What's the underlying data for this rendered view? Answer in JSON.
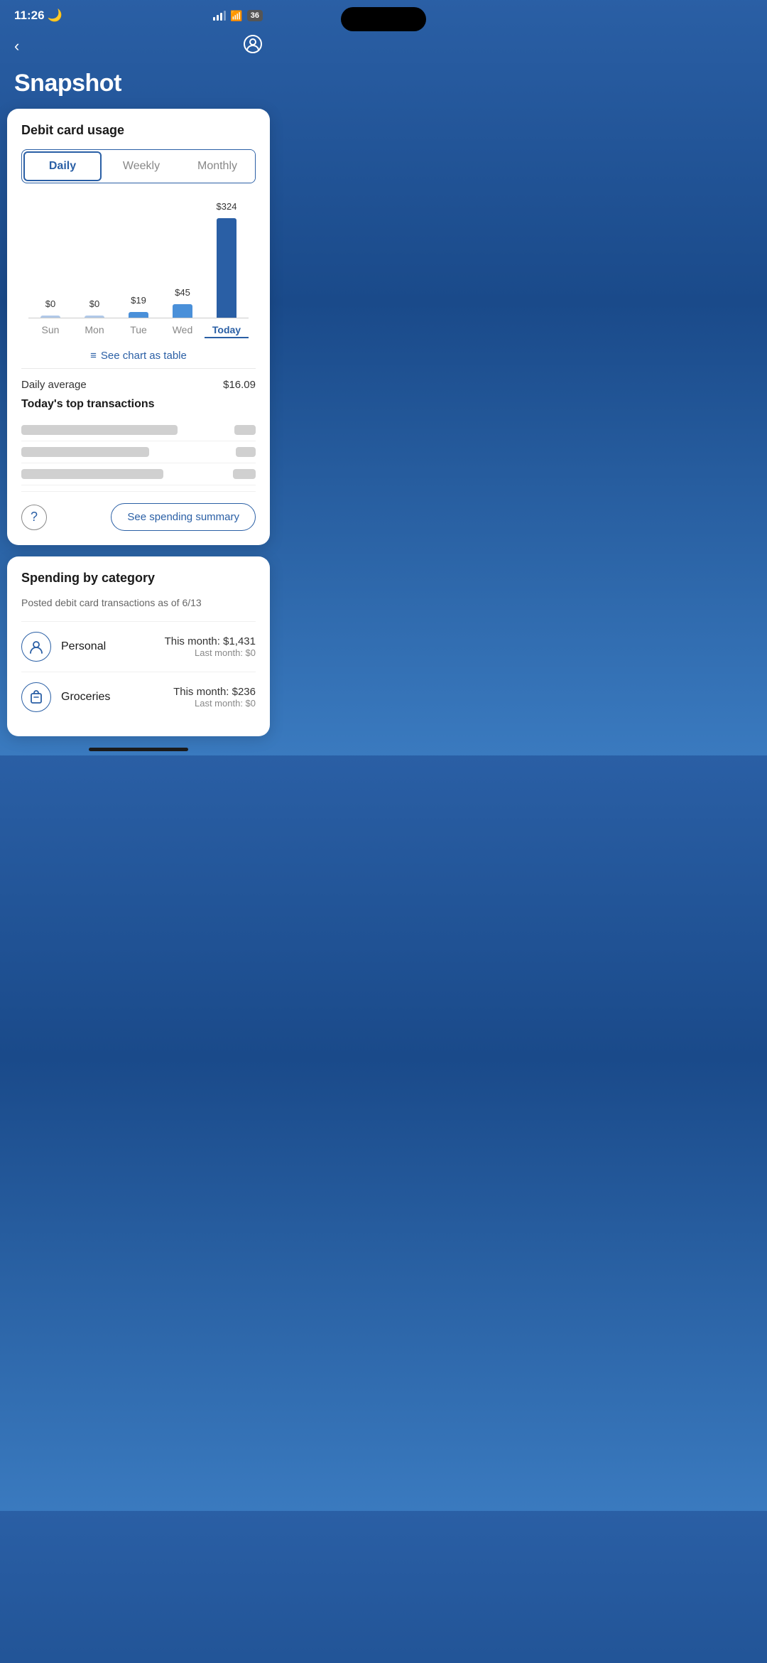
{
  "statusBar": {
    "time": "11:26",
    "moonIcon": "🌙"
  },
  "header": {
    "backLabel": "‹",
    "profileIconLabel": "profile",
    "title": "Snapshot"
  },
  "debitCard": {
    "sectionTitle": "Debit card usage",
    "tabs": [
      {
        "label": "Daily",
        "active": true
      },
      {
        "label": "Weekly",
        "active": false
      },
      {
        "label": "Monthly",
        "active": false
      }
    ],
    "chartDays": [
      {
        "day": "Sun",
        "amount": "$0",
        "value": 0,
        "isToday": false
      },
      {
        "day": "Mon",
        "amount": "$0",
        "value": 0,
        "isToday": false
      },
      {
        "day": "Tue",
        "amount": "$19",
        "value": 19,
        "isToday": false
      },
      {
        "day": "Wed",
        "amount": "$45",
        "value": 45,
        "isToday": false
      },
      {
        "day": "Today",
        "amount": "$324",
        "value": 324,
        "isToday": true
      }
    ],
    "maxValue": 324,
    "chartHeight": 140,
    "seeChartLabel": "See chart as table",
    "dailyAverageLabel": "Daily average",
    "dailyAverageValue": "$16.09",
    "topTransactionsTitle": "Today's top transactions",
    "transactions": [
      {
        "blurWidth": 220,
        "amountBlurWidth": 30
      },
      {
        "blurWidth": 180,
        "amountBlurWidth": 28
      },
      {
        "blurWidth": 200,
        "amountBlurWidth": 32
      }
    ],
    "helpIcon": "?",
    "seeSpendingLabel": "See spending summary"
  },
  "spendingCategory": {
    "sectionTitle": "Spending by category",
    "subtitle": "Posted debit card transactions as of 6/13",
    "categories": [
      {
        "name": "Personal",
        "icon": "person",
        "thisMonth": "This month: $1,431",
        "lastMonth": "Last month: $0"
      },
      {
        "name": "Groceries",
        "icon": "bag",
        "thisMonth": "This month: $236",
        "lastMonth": "Last month: $0"
      }
    ]
  }
}
